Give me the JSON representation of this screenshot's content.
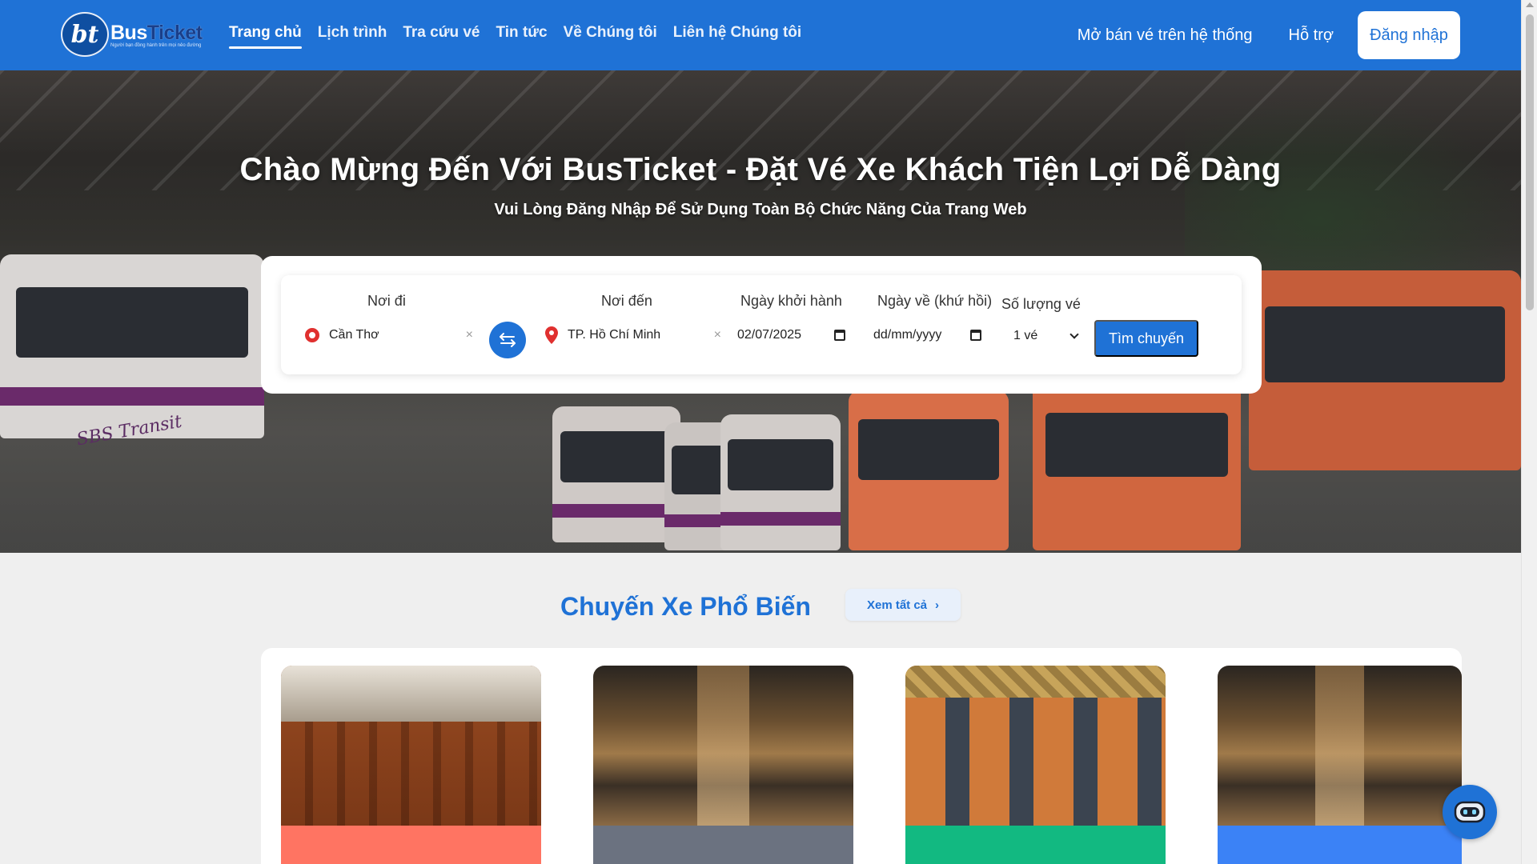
{
  "header": {
    "logo": {
      "mark": "bt",
      "name_part1": "Bus",
      "name_part2": "Ticket",
      "tagline": "Người bạn đồng hành trên mọi nẻo đường"
    },
    "nav": [
      {
        "label": "Trang chủ",
        "active": true
      },
      {
        "label": "Lịch trình"
      },
      {
        "label": "Tra cứu vé"
      },
      {
        "label": "Tin tức"
      },
      {
        "label": "Về Chúng tôi"
      },
      {
        "label": "Liên hệ Chúng tôi"
      }
    ],
    "right_links": {
      "open_sale": "Mở bán vé trên hệ thống",
      "support": "Hỗ trợ"
    },
    "login_label": "Đăng nhập",
    "brand_color": "#1f72d6"
  },
  "hero": {
    "title": "Chào Mừng Đến Với BusTicket - Đặt Vé Xe Khách Tiện Lợi Dễ Dàng",
    "subtitle": "Vui Lòng Đăng Nhập Để Sử Dụng Toàn Bộ Chức Năng Của Trang Web",
    "bus_livery_text": "SBS Transit"
  },
  "search": {
    "from_label": "Nơi đi",
    "from_value": "Cần Thơ",
    "to_label": "Nơi đến",
    "to_value": "TP. Hồ Chí Minh",
    "depart_label": "Ngày khởi hành",
    "depart_value": "02/07/2025",
    "return_label": "Ngày về (khứ hồi)",
    "return_placeholder": "dd/mm/yyyy",
    "qty_label": "Số lượng vé",
    "qty_value": "1 vé",
    "clear_symbol": "×",
    "search_button": "Tìm chuyến"
  },
  "popular": {
    "title": "Chuyến Xe Phổ Biến",
    "see_all": "Xem tất cả",
    "see_all_arrow": "›",
    "cards": [
      {
        "band_color": "#ff7462"
      },
      {
        "band_color": "#6b7280"
      },
      {
        "band_color": "#12b981"
      },
      {
        "band_color": "#3b82f6"
      }
    ]
  }
}
